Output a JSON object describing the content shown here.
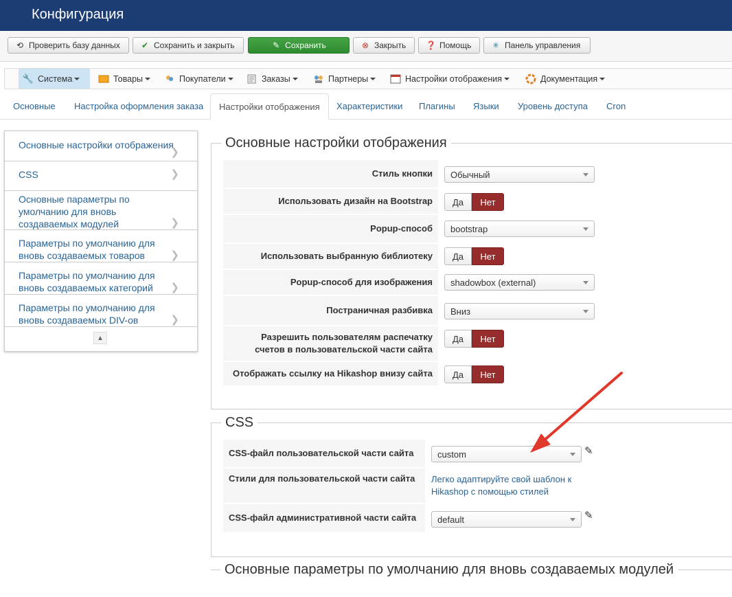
{
  "header": {
    "title": "Конфигурация"
  },
  "toolbar": {
    "check_db": "Проверить базу данных",
    "save_close": "Сохранить и закрыть",
    "save": "Сохранить",
    "close": "Закрыть",
    "help": "Помощь",
    "dashboard": "Панель управления"
  },
  "menu": {
    "items": [
      {
        "label": "Система",
        "icon": "wrench-icon"
      },
      {
        "label": "Товары",
        "icon": "box-icon"
      },
      {
        "label": "Покупатели",
        "icon": "users-icon"
      },
      {
        "label": "Заказы",
        "icon": "orders-icon"
      },
      {
        "label": "Партнеры",
        "icon": "partners-icon"
      },
      {
        "label": "Настройки отображения",
        "icon": "display-icon"
      },
      {
        "label": "Документация",
        "icon": "help-ring-icon"
      }
    ]
  },
  "tabs": [
    "Основные",
    "Настройка оформления заказа",
    "Настройки отображения",
    "Характеристики",
    "Плагины",
    "Языки",
    "Уровень доступа",
    "Cron"
  ],
  "sidenav": {
    "items": [
      "Основные настройки отображения",
      "CSS",
      "Основные параметры по умолчанию для вновь создаваемых модулей",
      "Параметры по умолчанию для вновь создаваемых товаров",
      "Параметры по умолчанию для вновь создаваемых категорий",
      "Параметры по умолчанию для вновь создаваемых DIV-ов"
    ]
  },
  "display_settings": {
    "legend": "Основные настройки отображения",
    "yes": "Да",
    "no": "Нет",
    "rows": [
      {
        "label": "Стиль кнопки",
        "value": "Обычный"
      },
      {
        "label": "Использовать дизайн на Bootstrap"
      },
      {
        "label": "Popup-способ",
        "value": "bootstrap"
      },
      {
        "label": "Использовать выбранную библиотеку"
      },
      {
        "label": "Popup-способ для изображения",
        "value": "shadowbox (external)"
      },
      {
        "label": "Постраничная разбивка",
        "value": "Вниз"
      },
      {
        "label": "Разрешить пользователям распечатку счетов в пользовательской части сайта"
      },
      {
        "label": "Отображать ссылку на Hikashop внизу сайта"
      }
    ]
  },
  "css": {
    "legend": "CSS",
    "rows": [
      {
        "label": "CSS-файл пользовательской части сайта",
        "value": "custom"
      },
      {
        "label": "Стили для пользовательской части сайта",
        "link": "Легко адаптируйте свой шаблон к Hikashop с помощью стилей"
      },
      {
        "label": "CSS-файл административной части сайта",
        "value": "default"
      }
    ]
  },
  "modules_section": {
    "legend": "Основные параметры по умолчанию для вновь создаваемых модулей"
  },
  "colors": {
    "header": "#1c3d74",
    "save_button": "#46a546",
    "toggle_no": "#962c2c",
    "link": "#2a6496",
    "arrow": "#e0392b"
  }
}
